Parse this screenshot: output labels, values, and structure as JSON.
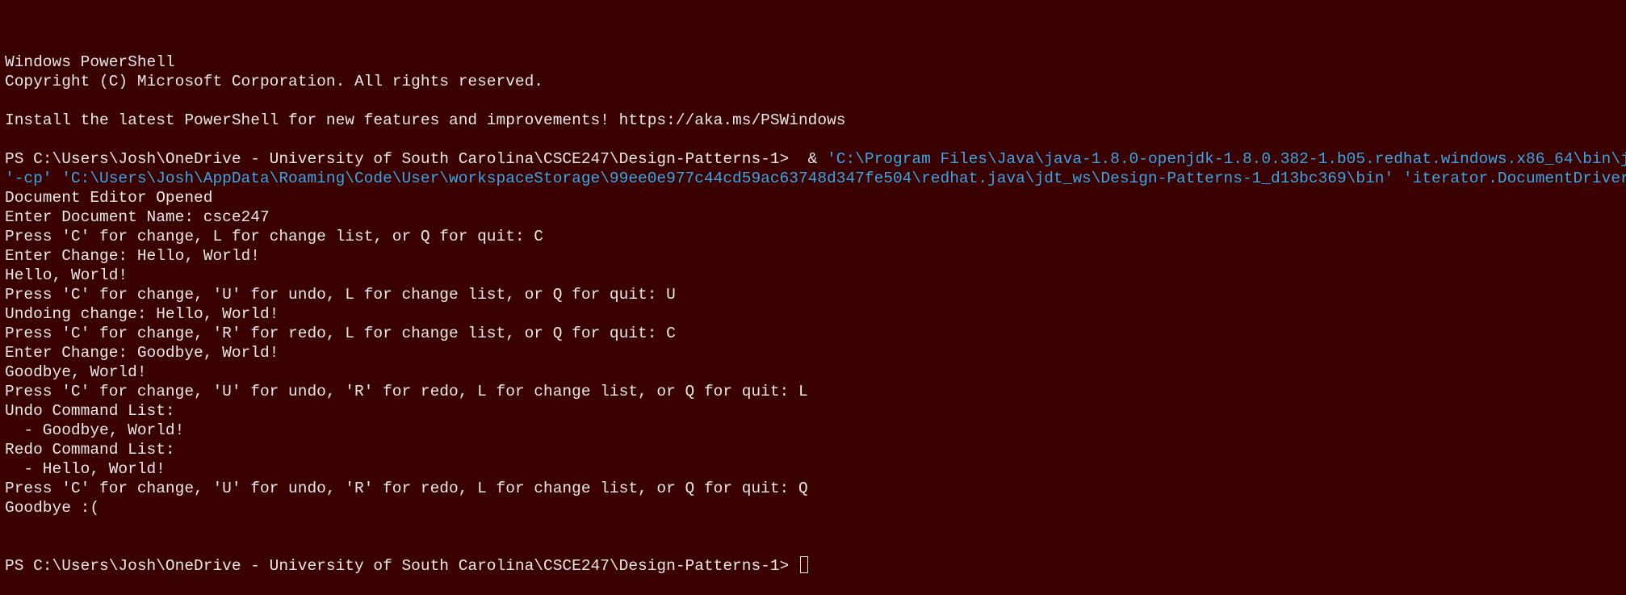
{
  "window": {
    "app": "Windows PowerShell"
  },
  "lines": [
    [
      {
        "text": "Windows PowerShell",
        "color": "default"
      }
    ],
    [
      {
        "text": "Copyright (C) Microsoft Corporation. All rights reserved.",
        "color": "default"
      }
    ],
    [
      {
        "text": "",
        "color": "default"
      }
    ],
    [
      {
        "text": "Install the latest PowerShell for new features and improvements! https://aka.ms/PSWindows",
        "color": "default"
      }
    ],
    [
      {
        "text": "",
        "color": "default"
      }
    ],
    [
      {
        "text": "PS C:\\Users\\Josh\\OneDrive - University of South Carolina\\CSCE247\\Design-Patterns-1>  & ",
        "color": "default"
      },
      {
        "text": "'C:\\Program Files\\Java\\java-1.8.0-openjdk-1.8.0.382-1.b05.redhat.windows.x86_64\\bin\\java.exe'",
        "color": "cyan"
      }
    ],
    [
      {
        "text": "'-cp' 'C:\\Users\\Josh\\AppData\\Roaming\\Code\\User\\workspaceStorage\\99ee0e977c44cd59ac63748d347fe504\\redhat.java\\jdt_ws\\Design-Patterns-1_d13bc369\\bin' 'iterator.DocumentDriver'",
        "color": "cyan"
      }
    ],
    [
      {
        "text": "Document Editor Opened",
        "color": "default"
      }
    ],
    [
      {
        "text": "Enter Document Name: csce247",
        "color": "default"
      }
    ],
    [
      {
        "text": "Press 'C' for change, L for change list, or Q for quit: C",
        "color": "default"
      }
    ],
    [
      {
        "text": "Enter Change: Hello, World!",
        "color": "default"
      }
    ],
    [
      {
        "text": "Hello, World!",
        "color": "default"
      }
    ],
    [
      {
        "text": "Press 'C' for change, 'U' for undo, L for change list, or Q for quit: U",
        "color": "default"
      }
    ],
    [
      {
        "text": "Undoing change: Hello, World!",
        "color": "default"
      }
    ],
    [
      {
        "text": "Press 'C' for change, 'R' for redo, L for change list, or Q for quit: C",
        "color": "default"
      }
    ],
    [
      {
        "text": "Enter Change: Goodbye, World!",
        "color": "default"
      }
    ],
    [
      {
        "text": "Goodbye, World!",
        "color": "default"
      }
    ],
    [
      {
        "text": "Press 'C' for change, 'U' for undo, 'R' for redo, L for change list, or Q for quit: L",
        "color": "default"
      }
    ],
    [
      {
        "text": "Undo Command List:",
        "color": "default"
      }
    ],
    [
      {
        "text": "  - Goodbye, World!",
        "color": "default"
      }
    ],
    [
      {
        "text": "Redo Command List:",
        "color": "default"
      }
    ],
    [
      {
        "text": "  - Hello, World!",
        "color": "default"
      }
    ],
    [
      {
        "text": "Press 'C' for change, 'U' for undo, 'R' for redo, L for change list, or Q for quit: Q",
        "color": "default"
      }
    ],
    [
      {
        "text": "Goodbye :(",
        "color": "default"
      }
    ]
  ],
  "prompt": {
    "text": "PS C:\\Users\\Josh\\OneDrive - University of South Carolina\\CSCE247\\Design-Patterns-1> "
  },
  "colors": {
    "background": "#3a0000",
    "default": "#e8e8e8",
    "cyan": "#3aa6e6"
  }
}
